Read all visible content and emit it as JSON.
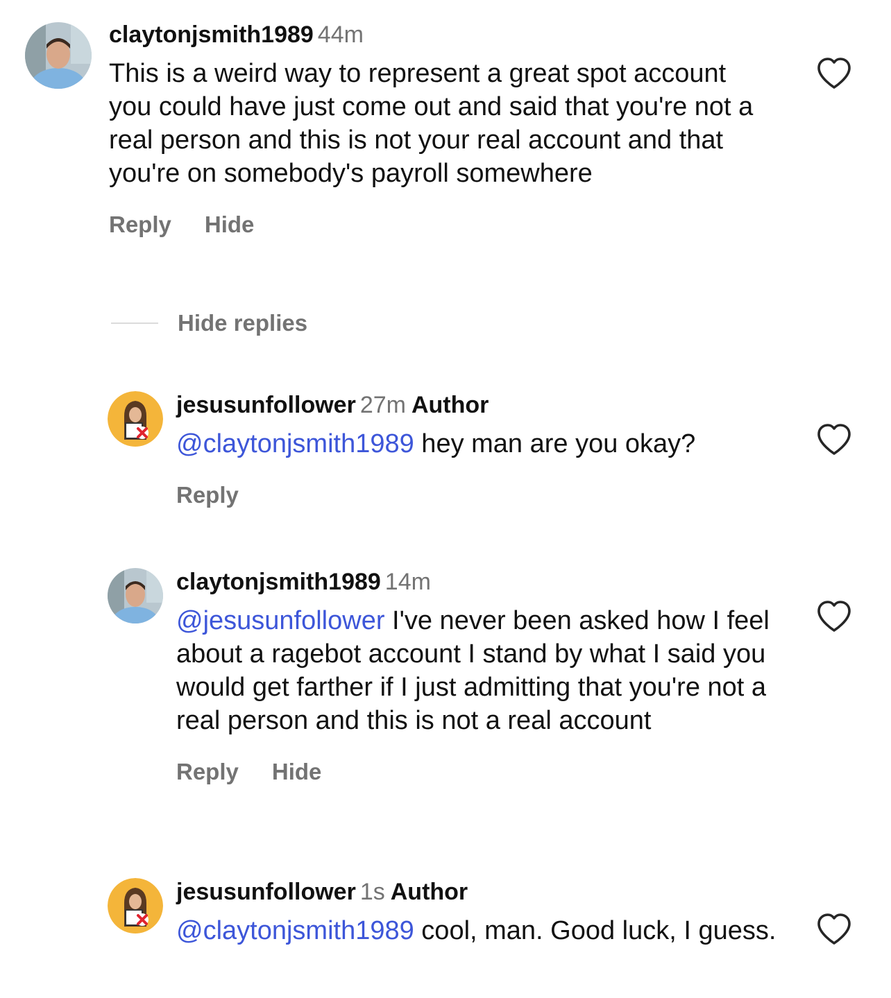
{
  "comments": [
    {
      "username": "claytonjsmith1989",
      "time": "44m",
      "author_badge": "",
      "mention": "",
      "text": "This is a weird way to represent a great spot account you could have just come out and said that you're not a real person and this is not your real account and that you're on  somebody's payroll somewhere",
      "reply_label": "Reply",
      "hide_label": "Hide",
      "avatar": "user-photo-avatar"
    },
    {
      "username": "jesusunfollower",
      "time": "27m",
      "author_badge": "Author",
      "mention": "@claytonjsmith1989",
      "text": " hey man are you okay?",
      "reply_label": "Reply",
      "hide_label": "",
      "avatar": "jesus-unfollow-avatar"
    },
    {
      "username": "claytonjsmith1989",
      "time": "14m",
      "author_badge": "",
      "mention": "@jesusunfollower",
      "text": " I've never been asked how I feel about a ragebot account I stand by what I said you would get farther if I just admitting that you're not a real person and this is not a real account",
      "reply_label": "Reply",
      "hide_label": "Hide",
      "avatar": "user-photo-avatar"
    },
    {
      "username": "jesusunfollower",
      "time": "1s",
      "author_badge": "Author",
      "mention": "@claytonjsmith1989",
      "text": " cool, man. Good luck, I guess.",
      "reply_label": "",
      "hide_label": "",
      "avatar": "jesus-unfollow-avatar"
    }
  ],
  "replies_toggle": {
    "label": "Hide replies"
  },
  "colors": {
    "mention": "#3d56d9",
    "secondary_text": "#737373",
    "avatar_yellow": "#f4b53a"
  },
  "icons": {
    "like": "heart-outline-icon"
  }
}
